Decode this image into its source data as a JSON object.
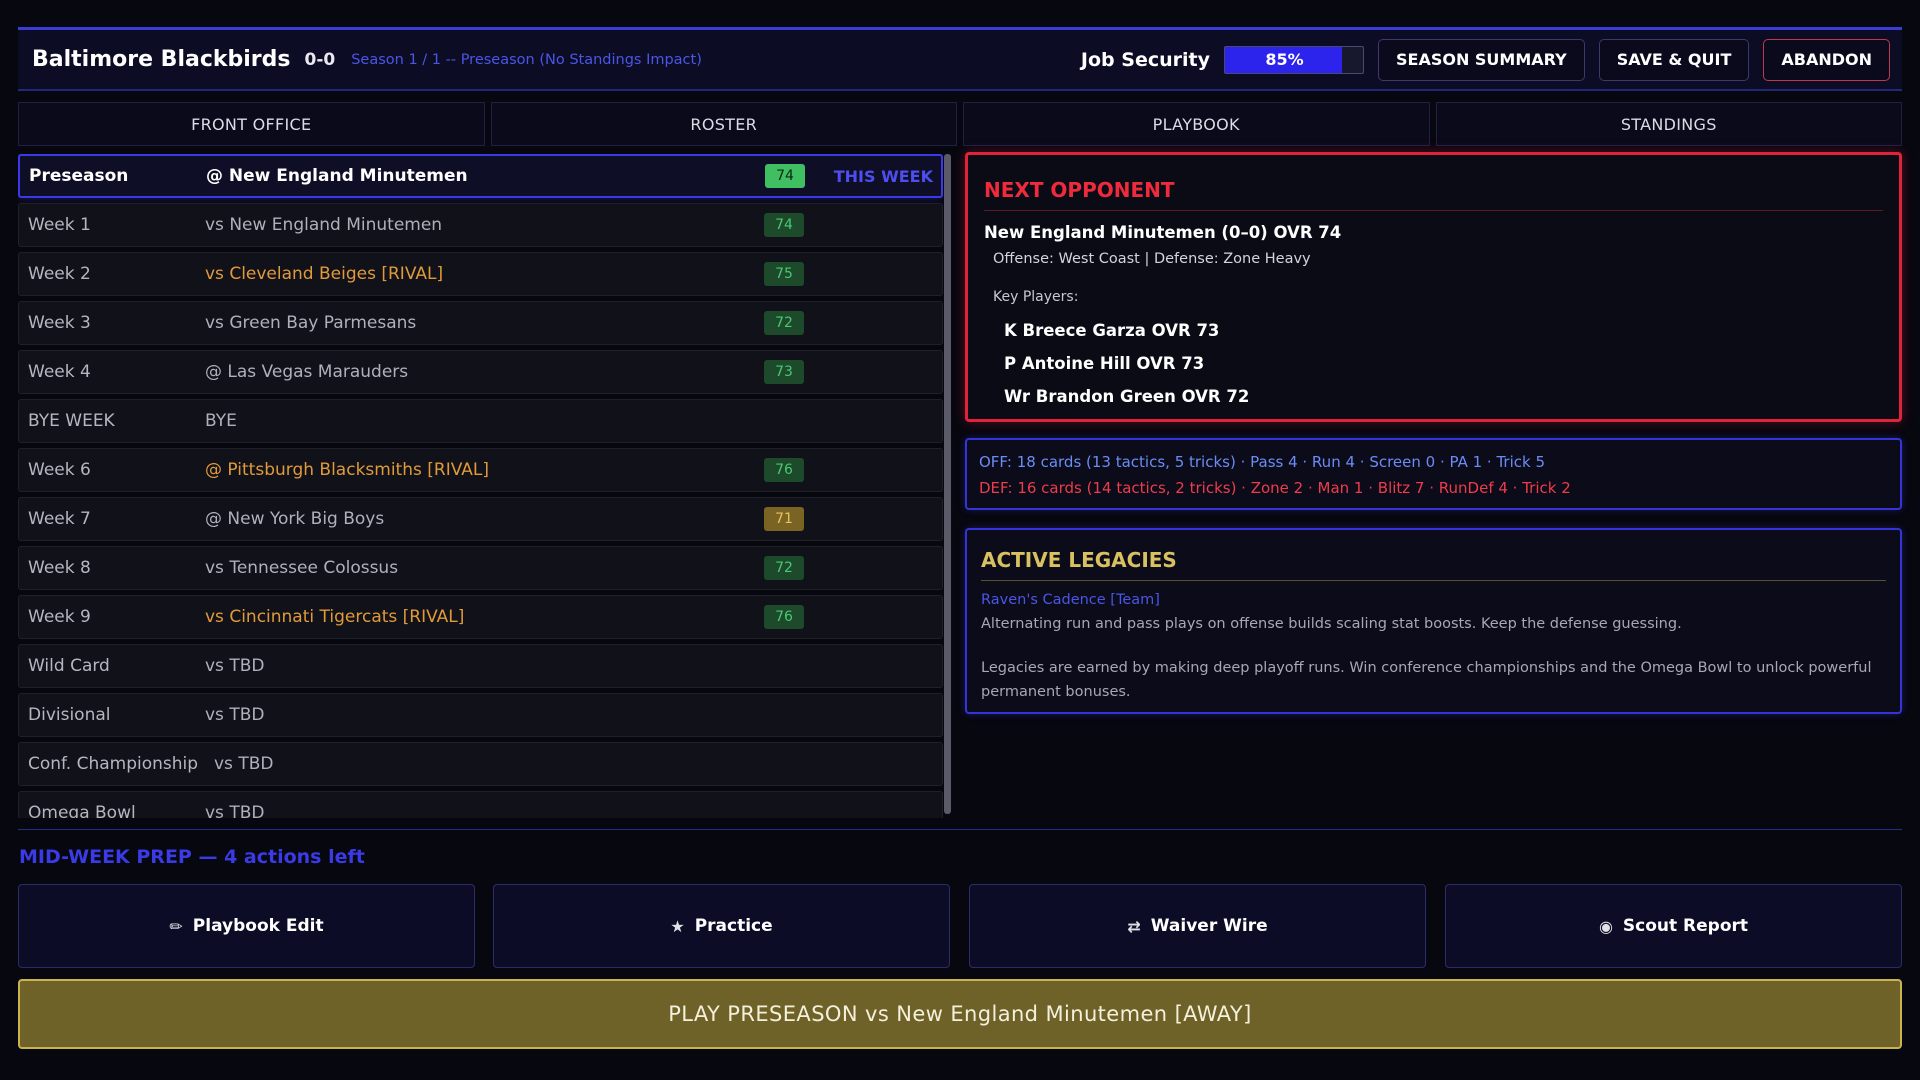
{
  "header": {
    "team_name": "Baltimore Blackbirds",
    "record": "0-0",
    "season_info": "Season 1 / 1 -- Preseason  (No Standings Impact)",
    "job_security_label": "Job Security",
    "job_security_value": "85%",
    "job_security_fraction": 0.85,
    "buttons": {
      "season_summary": "SEASON SUMMARY",
      "save_quit": "SAVE & QUIT",
      "abandon": "ABANDON"
    }
  },
  "tabs": [
    "FRONT OFFICE",
    "ROSTER",
    "PLAYBOOK",
    "STANDINGS"
  ],
  "schedule": [
    {
      "week": "Preseason",
      "opponent": "@ New England Minutemen",
      "ovr": "74",
      "rival": false,
      "current": true,
      "badge": "THIS WEEK",
      "ovr_style": "bright"
    },
    {
      "week": "Week 1",
      "opponent": "vs New England Minutemen",
      "ovr": "74",
      "rival": false,
      "current": false,
      "ovr_style": "dim"
    },
    {
      "week": "Week 2",
      "opponent": "vs Cleveland Beiges  [RIVAL]",
      "ovr": "75",
      "rival": true,
      "current": false,
      "ovr_style": "dim"
    },
    {
      "week": "Week 3",
      "opponent": "vs Green Bay Parmesans",
      "ovr": "72",
      "rival": false,
      "current": false,
      "ovr_style": "dim"
    },
    {
      "week": "Week 4",
      "opponent": "@ Las Vegas Marauders",
      "ovr": "73",
      "rival": false,
      "current": false,
      "ovr_style": "dim"
    },
    {
      "week": "BYE WEEK",
      "opponent": "BYE",
      "ovr": "",
      "rival": false,
      "current": false
    },
    {
      "week": "Week 6",
      "opponent": "@ Pittsburgh Blacksmiths  [RIVAL]",
      "ovr": "76",
      "rival": true,
      "current": false,
      "ovr_style": "dim"
    },
    {
      "week": "Week 7",
      "opponent": "@ New York Big Boys",
      "ovr": "71",
      "rival": false,
      "current": false,
      "ovr_style": "amber"
    },
    {
      "week": "Week 8",
      "opponent": "vs Tennessee Colossus",
      "ovr": "72",
      "rival": false,
      "current": false,
      "ovr_style": "dim"
    },
    {
      "week": "Week 9",
      "opponent": "vs Cincinnati Tigercats  [RIVAL]",
      "ovr": "76",
      "rival": true,
      "current": false,
      "ovr_style": "dim"
    },
    {
      "week": "Wild Card",
      "opponent": "vs TBD",
      "ovr": "",
      "rival": false,
      "current": false
    },
    {
      "week": "Divisional",
      "opponent": "vs TBD",
      "ovr": "",
      "rival": false,
      "current": false
    },
    {
      "week": "Conf. Championship",
      "opponent": "vs TBD",
      "ovr": "",
      "rival": false,
      "current": false
    },
    {
      "week": "Omega Bowl",
      "opponent": "vs TBD",
      "ovr": "",
      "rival": false,
      "current": false
    }
  ],
  "next_opponent": {
    "title": "NEXT OPPONENT",
    "name_line": "New England Minutemen (0–0)   OVR 74",
    "scheme_line": "Offense: West Coast   |   Defense: Zone Heavy",
    "key_label": "Key Players:",
    "players": [
      "K Breece Garza  OVR 73",
      "P Antoine Hill  OVR 73",
      "Wr Brandon Green  OVR 72"
    ]
  },
  "cards": {
    "off": "OFF: 18 cards (13 tactics, 5 tricks)  ·  Pass 4 · Run 4 · Screen 0 · PA 1 · Trick 5",
    "def": "DEF: 16 cards (14 tactics, 2 tricks)  ·  Zone 2 · Man 1 · Blitz 7 · RunDef 4 · Trick 2"
  },
  "legacies": {
    "title": "ACTIVE LEGACIES",
    "name": "Raven's Cadence  [Team]",
    "desc": "Alternating run and pass plays on offense builds scaling stat boosts. Keep the defense guessing.",
    "note": "Legacies are earned by making deep playoff runs. Win conference championships and the Omega Bowl to unlock powerful permanent bonuses."
  },
  "midweek": {
    "title": "MID-WEEK PREP  —  4 actions left",
    "actions": [
      {
        "icon": "✏",
        "label": "Playbook Edit"
      },
      {
        "icon": "★",
        "label": "Practice"
      },
      {
        "icon": "⇄",
        "label": "Waiver Wire"
      },
      {
        "icon": "◉",
        "label": "Scout Report"
      }
    ]
  },
  "play_button": "PLAY  PRESEASON  vs  New England Minutemen  [AWAY]",
  "colors": {
    "accent_blue": "#3a3ae8",
    "rival_orange": "#e09a3a",
    "opponent_red": "#e0223a",
    "legacy_gold": "#d9c060",
    "play_gold": "#6e6228"
  }
}
